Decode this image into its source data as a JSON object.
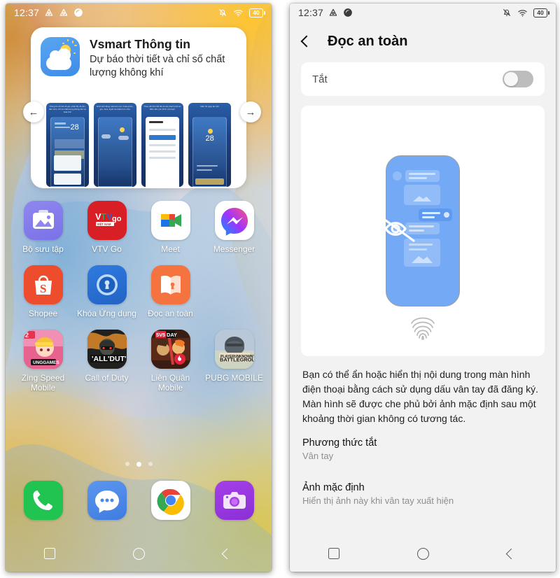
{
  "left_phone": {
    "status_bar": {
      "time": "12:37",
      "left_icons": [
        "vpn-icon",
        "vpn-icon",
        "eclipse-icon"
      ],
      "right_icons": [
        "mute-icon",
        "wifi-icon",
        "battery-icon"
      ],
      "battery_level": "40"
    },
    "widget": {
      "app_name": "Vsmart Thông tin",
      "description": "Dự báo thời tiết và chỉ số chất lượng không khí",
      "icon": "weather-app-icon",
      "prev_arrow": "←",
      "next_arrow": "→",
      "thumbnails": [
        {
          "caption": "Thông tin chi tiết về gió, nhiệt độ, độ ẩm, tầm nhìn, chỉ số chất lượng không khí và hoạt tính"
        },
        {
          "caption": "Hình ảnh động mặt trời mọc, hoàng hôn, gió, mưa, tuyết và nhiều hơn nữa"
        },
        {
          "caption": "Theo dõi thời tiết tất cả các thành phố và điểm đến yêu thích của bạn!"
        },
        {
          "caption": "Hiển thị ngày âm lịch"
        }
      ]
    },
    "apps": [
      [
        {
          "label": "Bộ sưu tập",
          "icon": "gallery-icon"
        },
        {
          "label": "VTV Go",
          "icon": "vtvgo-icon"
        },
        {
          "label": "Meet",
          "icon": "google-meet-icon"
        },
        {
          "label": "Messenger",
          "icon": "messenger-icon"
        }
      ],
      [
        {
          "label": "Shopee",
          "icon": "shopee-icon"
        },
        {
          "label": "Khóa Ứng dụng",
          "icon": "app-lock-icon"
        },
        {
          "label": "Đọc an toàn",
          "icon": "safe-read-icon"
        },
        {
          "label": "",
          "icon": ""
        }
      ],
      [
        {
          "label": "Zing Speed Mobile",
          "icon": "zing-speed-icon"
        },
        {
          "label": "Call of Duty",
          "icon": "call-of-duty-icon"
        },
        {
          "label": "Liên Quân Mobile",
          "icon": "lien-quan-icon"
        },
        {
          "label": "PUBG MOBILE",
          "icon": "pubg-mobile-icon"
        }
      ]
    ],
    "page_indicator": {
      "count": 3,
      "active": 1
    },
    "dock": [
      {
        "label": "Phone",
        "icon": "phone-icon"
      },
      {
        "label": "Messages",
        "icon": "messages-icon"
      },
      {
        "label": "Chrome",
        "icon": "chrome-icon"
      },
      {
        "label": "Camera",
        "icon": "camera-icon"
      }
    ],
    "nav_bar": {
      "recents": "recents-icon",
      "home": "home-icon",
      "back": "back-icon"
    }
  },
  "right_phone": {
    "status_bar": {
      "time": "12:37",
      "left_icons": [
        "vpn-icon",
        "eclipse-icon"
      ],
      "right_icons": [
        "mute-icon",
        "wifi-icon",
        "battery-icon"
      ],
      "battery_level": "40"
    },
    "header": {
      "title": "Đọc an toàn",
      "back": "back-chevron-icon"
    },
    "toggle": {
      "label": "Tắt",
      "state": "off"
    },
    "illustration": {
      "name": "hidden-content-phone-illustration",
      "phone_color": "#74aaf5",
      "eye_icon": "eye-off-icon",
      "fingerprint_icon": "fingerprint-icon"
    },
    "description": "Bạn có thể ẩn hoặc hiển thị nội dung trong màn hình điện thoại bằng cách sử dụng dấu vân tay đã đăng ký. Màn hình sẽ được che phủ bởi ảnh mặc định sau một khoảng thời gian không có tương tác.",
    "items": [
      {
        "title": "Phương thức tắt",
        "subtitle": "Vân tay"
      },
      {
        "title": "Ảnh mặc định",
        "subtitle": "Hiển thị ảnh này khi vân tay xuất hiện"
      }
    ],
    "nav_bar": {
      "recents": "recents-icon",
      "home": "home-icon",
      "back": "back-icon"
    }
  },
  "colors": {
    "accent_blue": "#74aaf5",
    "settings_bg": "#f2f2f2",
    "card_bg": "#ffffff",
    "toggle_off": "#bdbdbd"
  }
}
